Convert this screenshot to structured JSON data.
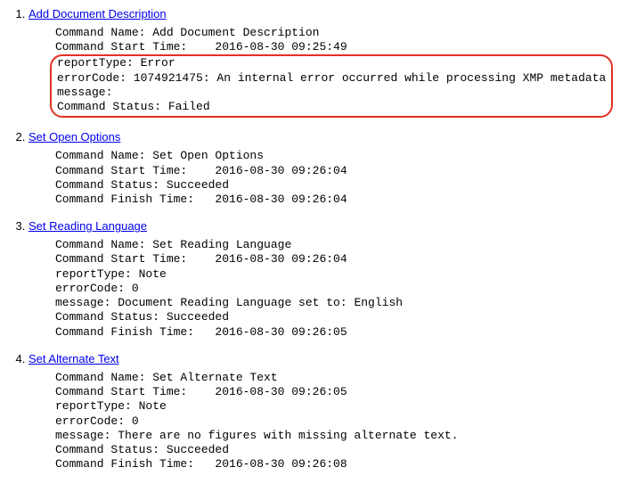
{
  "items": [
    {
      "number": "1.",
      "title": "Add Document Description",
      "plain_lines": [
        "Command Name: Add Document Description",
        "Command Start Time:    2016-08-30 09:25:49"
      ],
      "highlighted_lines": [
        "reportType: Error",
        "errorCode: 1074921475: An internal error occurred while processing XMP metadata",
        "message:",
        "Command Status: Failed"
      ]
    },
    {
      "number": "2.",
      "title": "Set Open Options",
      "plain_lines": [
        "Command Name: Set Open Options",
        "Command Start Time:    2016-08-30 09:26:04",
        "Command Status: Succeeded",
        "Command Finish Time:   2016-08-30 09:26:04"
      ],
      "highlighted_lines": []
    },
    {
      "number": "3.",
      "title": "Set Reading Language",
      "plain_lines": [
        "Command Name: Set Reading Language",
        "Command Start Time:    2016-08-30 09:26:04",
        "reportType: Note",
        "errorCode: 0",
        "message: Document Reading Language set to: English",
        "Command Status: Succeeded",
        "Command Finish Time:   2016-08-30 09:26:05"
      ],
      "highlighted_lines": []
    },
    {
      "number": "4.",
      "title": "Set Alternate Text",
      "plain_lines": [
        "Command Name: Set Alternate Text",
        "Command Start Time:    2016-08-30 09:26:05",
        "reportType: Note",
        "errorCode: 0",
        "message: There are no figures with missing alternate text.",
        "Command Status: Succeeded",
        "Command Finish Time:   2016-08-30 09:26:08"
      ],
      "highlighted_lines": []
    }
  ]
}
